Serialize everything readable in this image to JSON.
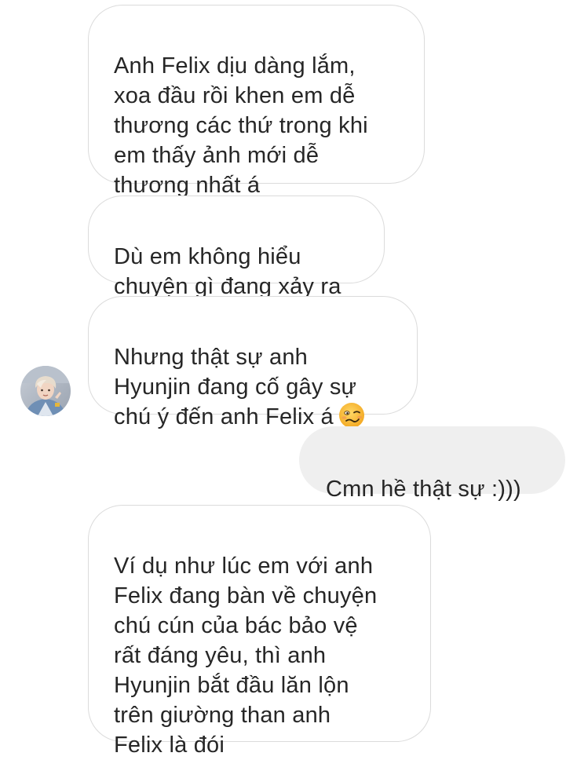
{
  "thread": {
    "messages": [
      {
        "direction": "incoming",
        "text": " Anh Felix dịu dàng lắm,\nxoa đầu rồi khen em dễ\nthương các thứ trong khi\nem thấy ảnh mới dễ\nthương nhất á"
      },
      {
        "direction": "incoming",
        "text": " Dù em không hiểu\nchuyện gì đang xảy ra"
      },
      {
        "direction": "incoming",
        "text": "Nhưng thật sự anh\nHyunjin đang cố gây sự\nchú ý đến anh Felix á",
        "emoji": "woozy-face-icon"
      },
      {
        "direction": "outgoing",
        "text": "Cmn hề thật sự :)))"
      },
      {
        "direction": "incoming",
        "text": " Ví dụ như lúc em với anh\nFelix đang bàn về chuyện\nchú cún của bác bảo vệ\nrất đáng yêu, thì anh\nHyunjin bắt đầu lăn lộn\ntrên giường than anh\nFelix là đói"
      }
    ],
    "avatar": {
      "icon": "contact-avatar"
    },
    "colors": {
      "incoming_bg": "#ffffff",
      "incoming_border": "#dbdbdb",
      "outgoing_bg": "#efefef",
      "text": "#262626",
      "emoji_face": "#f8c23a"
    }
  }
}
